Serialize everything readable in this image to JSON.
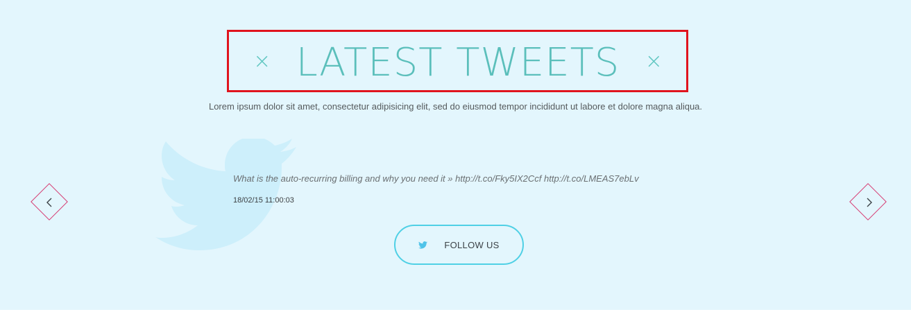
{
  "section": {
    "title": "LATEST TWEETS",
    "title_decor_left": "×",
    "title_decor_right": "×",
    "subtitle": "Lorem ipsum dolor sit amet, consectetur adipisicing elit, sed do eiusmod tempor incididunt ut labore et dolore magna aliqua."
  },
  "tweet": {
    "text": "What is the auto-recurring billing and why you need it » http://t.co/Fky5IX2Ccf http://t.co/LMEAS7ebLv",
    "date": "18/02/15 11:00:03"
  },
  "follow_button": {
    "label": "FOLLOW US",
    "icon": "twitter-icon"
  },
  "navigation": {
    "prev_icon": "chevron-left-icon",
    "next_icon": "chevron-right-icon"
  },
  "colors": {
    "background": "#e3f6fd",
    "title": "#5bbfbb",
    "nav_border": "#d63a72",
    "button_border": "#4fd0e5",
    "twitter_blue": "#4fc3e9",
    "bird_watermark": "#cdeffb",
    "highlight_box": "#e0141e"
  }
}
